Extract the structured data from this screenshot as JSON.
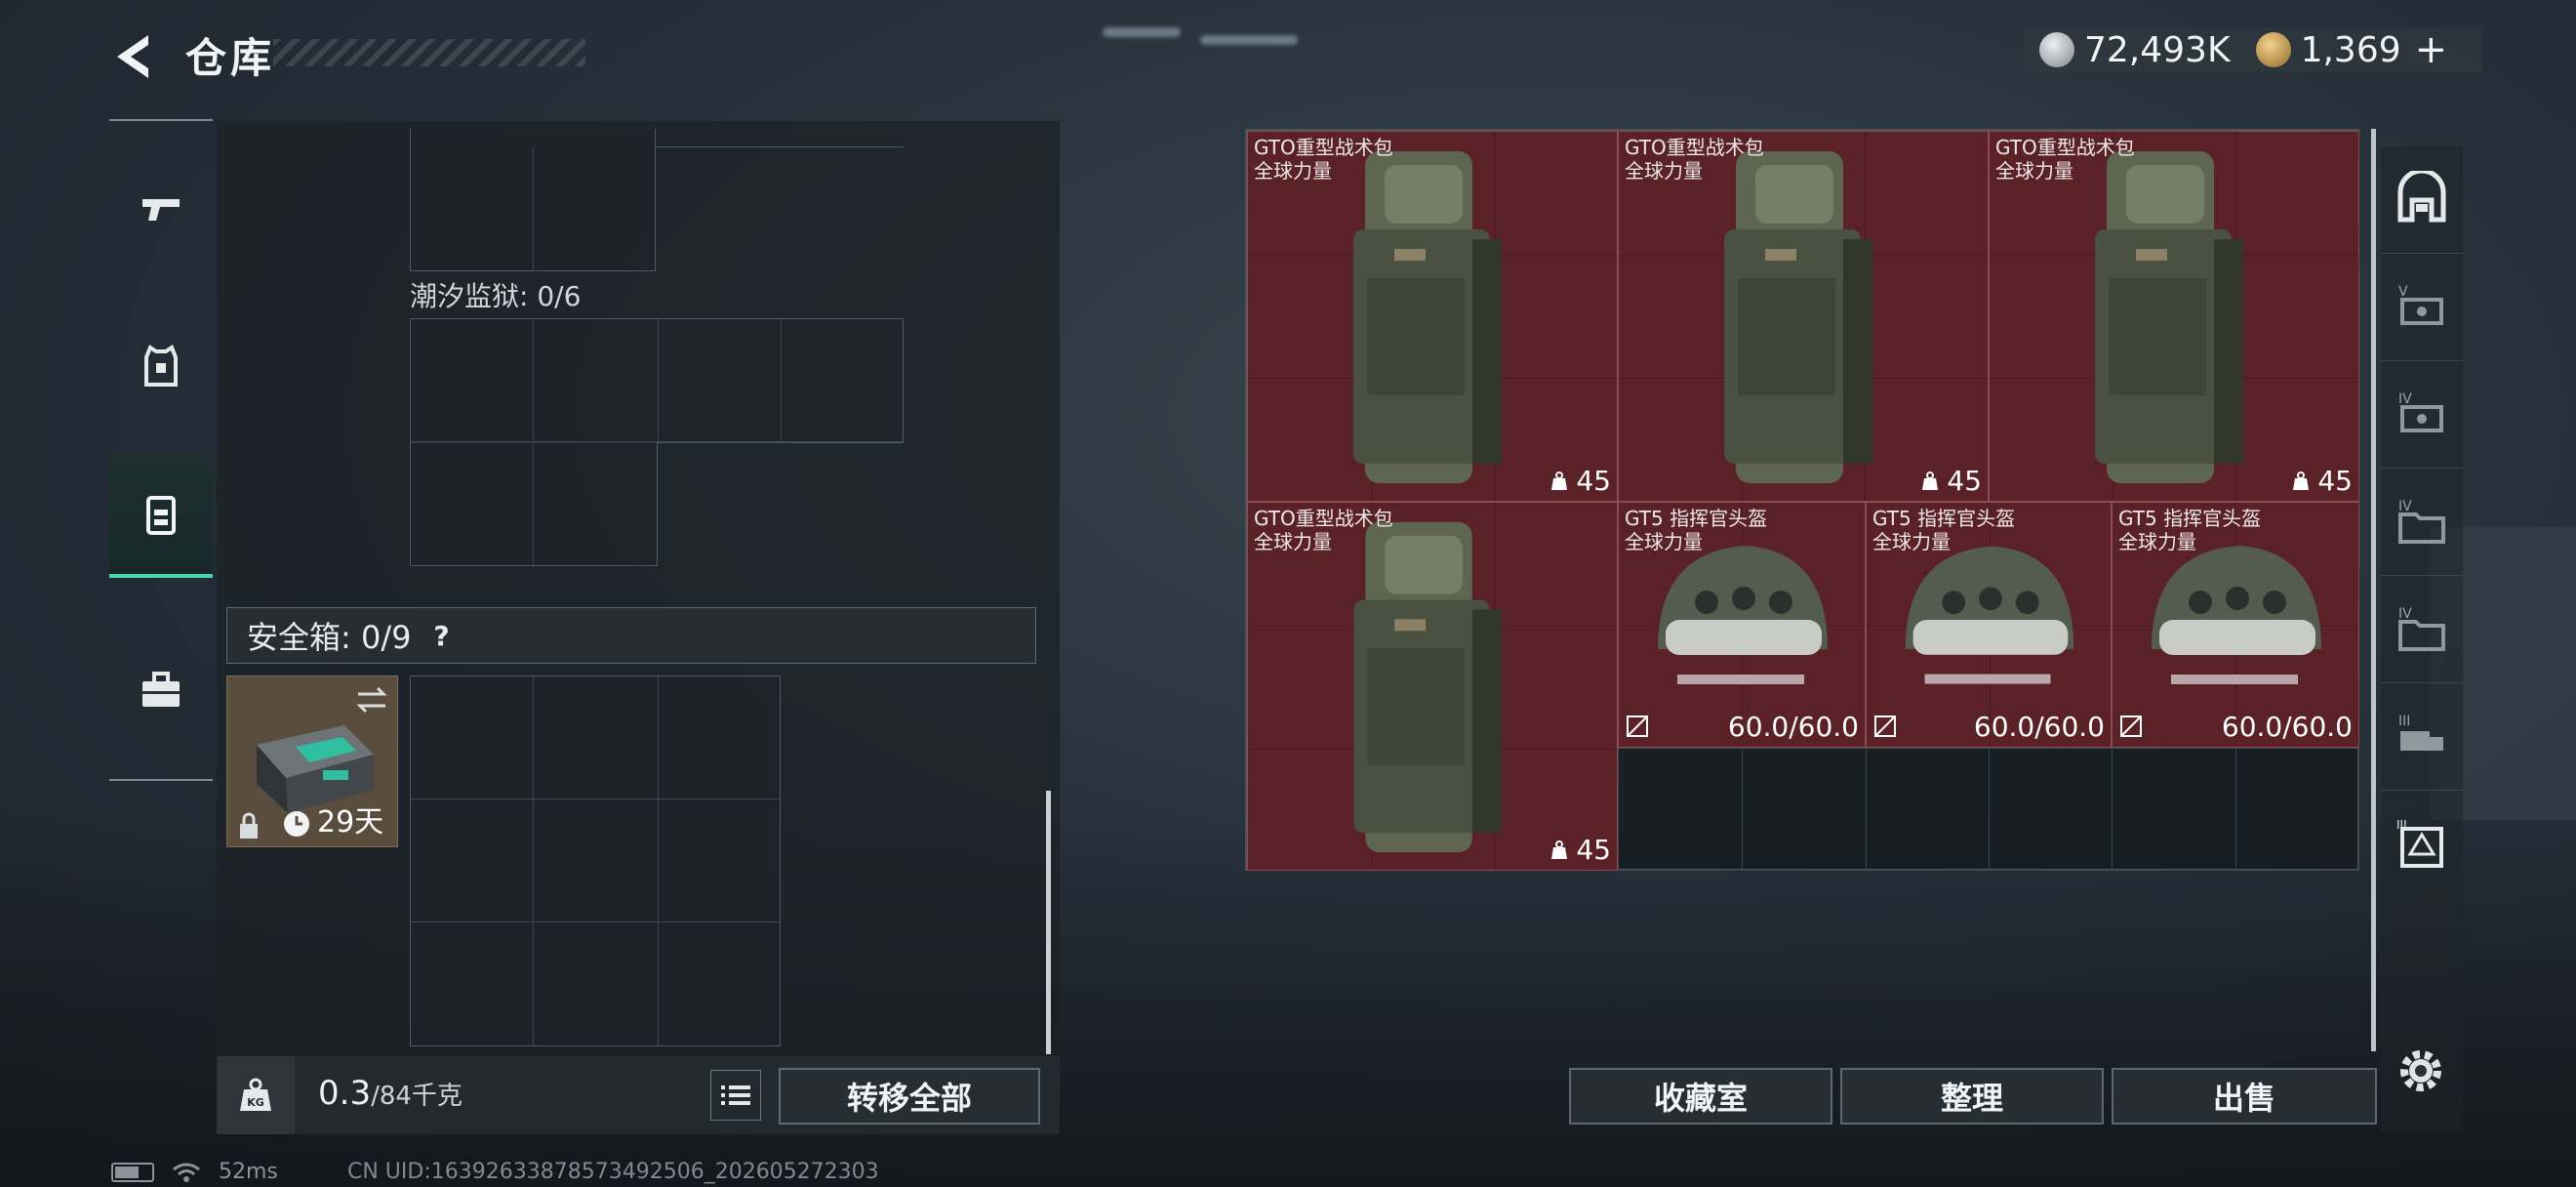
{
  "header": {
    "title": "仓库",
    "currency": {
      "silver_amount": "72,493K",
      "gold_amount": "1,369",
      "add_label": "+"
    }
  },
  "left_nav": {
    "items": [
      {
        "name": "weapons",
        "icon": "pistol-icon",
        "active": false
      },
      {
        "name": "armor",
        "icon": "vest-icon",
        "active": false
      },
      {
        "name": "backpack",
        "icon": "backpack-icon",
        "active": true
      },
      {
        "name": "toolbox",
        "icon": "toolbox-icon",
        "active": false
      }
    ]
  },
  "container": {
    "prison_label": "潮汐监狱: 0/6",
    "safebox_label": "安全箱: 0/9",
    "help_label": "?",
    "safe_item": {
      "days": "29天",
      "icon": "safebox-item-icon"
    }
  },
  "bottom_left": {
    "weight_value": "0.3",
    "weight_capacity": "/84千克",
    "transfer_all_label": "转移全部"
  },
  "stash": {
    "backpacks": [
      {
        "name": "GTO重型战术包",
        "sub": "全球力量",
        "count": "45"
      },
      {
        "name": "GTO重型战术包",
        "sub": "全球力量",
        "count": "45"
      },
      {
        "name": "GTO重型战术包",
        "sub": "全球力量",
        "count": "45"
      },
      {
        "name": "GTO重型战术包",
        "sub": "全球力量",
        "count": "45"
      }
    ],
    "helmets": [
      {
        "name": "GT5 指挥官头盔",
        "sub": "全球力量",
        "durability": "60.0/60.0"
      },
      {
        "name": "GT5 指挥官头盔",
        "sub": "全球力量",
        "durability": "60.0/60.0"
      },
      {
        "name": "GT5 指挥官头盔",
        "sub": "全球力量",
        "durability": "60.0/60.0"
      }
    ]
  },
  "right_nav": {
    "items": [
      "armory-icon",
      "tier-v-icon",
      "tier-iv-weapon-icon",
      "tier-iv-folder-icon",
      "tier-iv-folder-2-icon",
      "tier-iii-truck-icon",
      "tier-iii-frame-icon"
    ]
  },
  "actions": {
    "collection_label": "收藏室",
    "sort_label": "整理",
    "sell_label": "出售"
  },
  "status_bar": {
    "ping": "52ms",
    "uid": "CN UID:16392633878573492506_202605272303"
  },
  "colors": {
    "accent": "#4ad7b0",
    "item_bg": "#5a2227"
  }
}
